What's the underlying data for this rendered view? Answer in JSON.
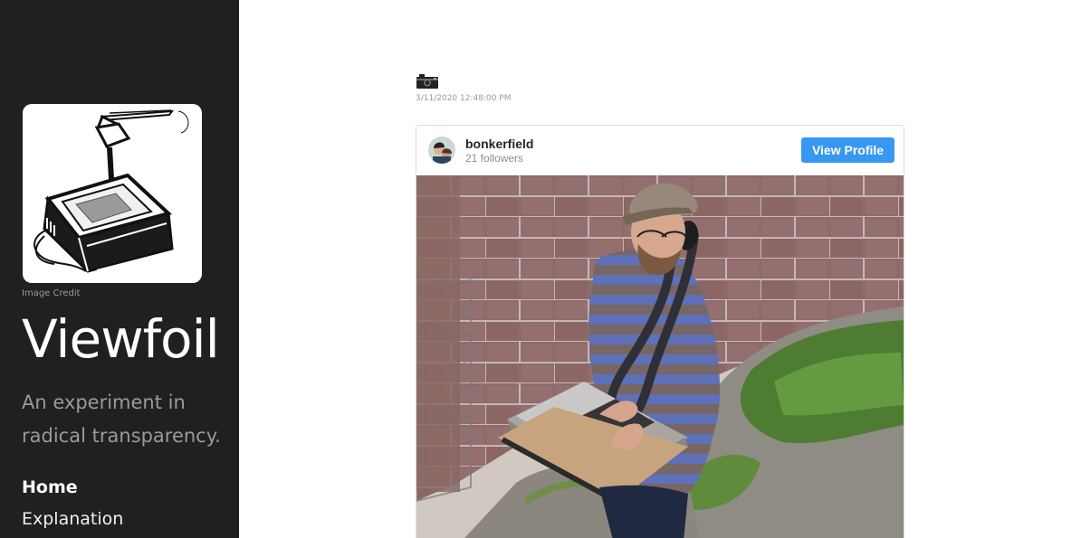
{
  "sidebar": {
    "logo_icon": "overhead-projector-logo",
    "image_credit": "Image Credit",
    "title": "Viewfoil",
    "tagline": "An experiment in radical transparency.",
    "nav": [
      {
        "label": "Home",
        "active": true
      },
      {
        "label": "Explanation",
        "active": false
      }
    ]
  },
  "post": {
    "icon": "camera-icon",
    "date": "3/11/2020 12:48:00 PM"
  },
  "instagram_embed": {
    "username": "bonkerfield",
    "followers": "21 followers",
    "button_label": "View Profile",
    "button_color": "#3897f0",
    "photo_icon": "man-with-laptop-standing-desk-photo"
  }
}
